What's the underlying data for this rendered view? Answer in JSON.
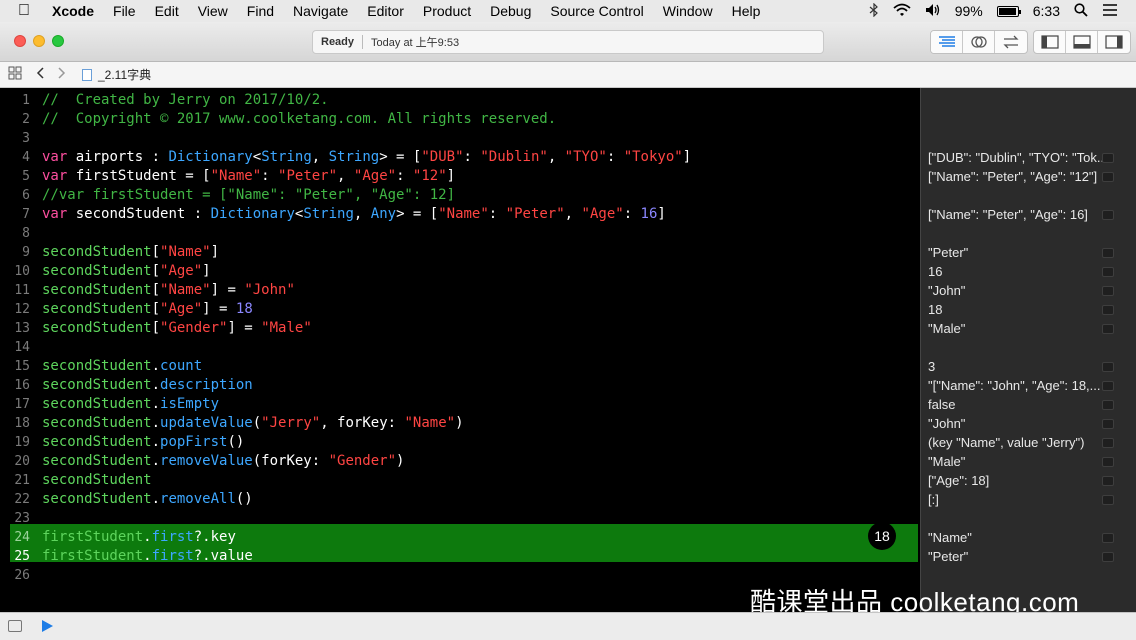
{
  "menubar": {
    "items": [
      "Xcode",
      "File",
      "Edit",
      "View",
      "Find",
      "Navigate",
      "Editor",
      "Product",
      "Debug",
      "Source Control",
      "Window",
      "Help"
    ],
    "battery": "99%",
    "time": "6:33"
  },
  "toolbar": {
    "status": "Ready",
    "timestamp": "Today at 上午9:53"
  },
  "jumpbar": {
    "filename": "_2.11字典"
  },
  "editor": {
    "badge": "18",
    "line_numbers": [
      "1",
      "2",
      "3",
      "4",
      "5",
      "6",
      "7",
      "8",
      "9",
      "10",
      "11",
      "12",
      "13",
      "14",
      "15",
      "16",
      "17",
      "18",
      "19",
      "20",
      "21",
      "22",
      "23",
      "24",
      "25",
      "26"
    ],
    "lines": [
      [
        [
          "cm",
          "//  Created by Jerry on 2017/10/2."
        ]
      ],
      [
        [
          "cm",
          "//  Copyright © 2017 www.coolketang.com. All rights reserved."
        ]
      ],
      [],
      [
        [
          "kw",
          "var"
        ],
        [
          "pl",
          " airports : "
        ],
        [
          "ty",
          "Dictionary"
        ],
        [
          "pl",
          "<"
        ],
        [
          "ty",
          "String"
        ],
        [
          "pl",
          ", "
        ],
        [
          "ty",
          "String"
        ],
        [
          "pl",
          "> = ["
        ],
        [
          "st",
          "\"DUB\""
        ],
        [
          "pl",
          ": "
        ],
        [
          "st",
          "\"Dublin\""
        ],
        [
          "pl",
          ", "
        ],
        [
          "st",
          "\"TYO\""
        ],
        [
          "pl",
          ": "
        ],
        [
          "st",
          "\"Tokyo\""
        ],
        [
          "pl",
          "]"
        ]
      ],
      [
        [
          "kw",
          "var"
        ],
        [
          "pl",
          " firstStudent = ["
        ],
        [
          "st",
          "\"Name\""
        ],
        [
          "pl",
          ": "
        ],
        [
          "st",
          "\"Peter\""
        ],
        [
          "pl",
          ", "
        ],
        [
          "st",
          "\"Age\""
        ],
        [
          "pl",
          ": "
        ],
        [
          "st",
          "\"12\""
        ],
        [
          "pl",
          "]"
        ]
      ],
      [
        [
          "cm",
          "//var firstStudent = [\"Name\": \"Peter\", \"Age\": 12]"
        ]
      ],
      [
        [
          "kw",
          "var"
        ],
        [
          "pl",
          " secondStudent : "
        ],
        [
          "ty",
          "Dictionary"
        ],
        [
          "pl",
          "<"
        ],
        [
          "ty",
          "String"
        ],
        [
          "pl",
          ", "
        ],
        [
          "ty",
          "Any"
        ],
        [
          "pl",
          "> = ["
        ],
        [
          "st",
          "\"Name\""
        ],
        [
          "pl",
          ": "
        ],
        [
          "st",
          "\"Peter\""
        ],
        [
          "pl",
          ", "
        ],
        [
          "st",
          "\"Age\""
        ],
        [
          "pl",
          ": "
        ],
        [
          "nm",
          "16"
        ],
        [
          "pl",
          "]"
        ]
      ],
      [],
      [
        [
          "vr",
          "secondStudent"
        ],
        [
          "pl",
          "["
        ],
        [
          "st",
          "\"Name\""
        ],
        [
          "pl",
          "]"
        ]
      ],
      [
        [
          "vr",
          "secondStudent"
        ],
        [
          "pl",
          "["
        ],
        [
          "st",
          "\"Age\""
        ],
        [
          "pl",
          "]"
        ]
      ],
      [
        [
          "vr",
          "secondStudent"
        ],
        [
          "pl",
          "["
        ],
        [
          "st",
          "\"Name\""
        ],
        [
          "pl",
          "] = "
        ],
        [
          "st",
          "\"John\""
        ]
      ],
      [
        [
          "vr",
          "secondStudent"
        ],
        [
          "pl",
          "["
        ],
        [
          "st",
          "\"Age\""
        ],
        [
          "pl",
          "] = "
        ],
        [
          "nm",
          "18"
        ]
      ],
      [
        [
          "vr",
          "secondStudent"
        ],
        [
          "pl",
          "["
        ],
        [
          "st",
          "\"Gender\""
        ],
        [
          "pl",
          "] = "
        ],
        [
          "st",
          "\"Male\""
        ]
      ],
      [],
      [
        [
          "vr",
          "secondStudent"
        ],
        [
          "pl",
          "."
        ],
        [
          "pr",
          "count"
        ]
      ],
      [
        [
          "vr",
          "secondStudent"
        ],
        [
          "pl",
          "."
        ],
        [
          "pr",
          "description"
        ]
      ],
      [
        [
          "vr",
          "secondStudent"
        ],
        [
          "pl",
          "."
        ],
        [
          "pr",
          "isEmpty"
        ]
      ],
      [
        [
          "vr",
          "secondStudent"
        ],
        [
          "pl",
          "."
        ],
        [
          "pr",
          "updateValue"
        ],
        [
          "pl",
          "("
        ],
        [
          "st",
          "\"Jerry\""
        ],
        [
          "pl",
          ", forKey: "
        ],
        [
          "st",
          "\"Name\""
        ],
        [
          "pl",
          ")"
        ]
      ],
      [
        [
          "vr",
          "secondStudent"
        ],
        [
          "pl",
          "."
        ],
        [
          "pr",
          "popFirst"
        ],
        [
          "pl",
          "()"
        ]
      ],
      [
        [
          "vr",
          "secondStudent"
        ],
        [
          "pl",
          "."
        ],
        [
          "pr",
          "removeValue"
        ],
        [
          "pl",
          "(forKey: "
        ],
        [
          "st",
          "\"Gender\""
        ],
        [
          "pl",
          ")"
        ]
      ],
      [
        [
          "vr",
          "secondStudent"
        ]
      ],
      [
        [
          "vr",
          "secondStudent"
        ],
        [
          "pl",
          "."
        ],
        [
          "pr",
          "removeAll"
        ],
        [
          "pl",
          "()"
        ]
      ],
      [],
      [
        [
          "vr",
          "firstStudent"
        ],
        [
          "pl",
          "."
        ],
        [
          "pr",
          "first"
        ],
        [
          "pl",
          "?.key"
        ]
      ],
      [
        [
          "vr",
          "firstStudent"
        ],
        [
          "pl",
          "."
        ],
        [
          "pr",
          "first"
        ],
        [
          "pl",
          "?.value"
        ]
      ],
      []
    ]
  },
  "results": {
    "lines": [
      "",
      "",
      "",
      "[\"DUB\": \"Dublin\", \"TYO\": \"Tok...",
      "[\"Name\": \"Peter\", \"Age\": \"12\"]",
      "",
      "[\"Name\": \"Peter\", \"Age\": 16]",
      "",
      "\"Peter\"",
      "16",
      "\"John\"",
      "18",
      "\"Male\"",
      "",
      "3",
      "\"[\"Name\": \"John\", \"Age\": 18,...",
      "false",
      "\"John\"",
      "(key \"Name\", value \"Jerry\")",
      "\"Male\"",
      "[\"Age\": 18]",
      "[:]",
      "",
      "\"Name\"",
      "\"Peter\"",
      ""
    ]
  },
  "watermark": "酷课堂出品 coolketang.com",
  "colors": {
    "highlight": "#0d7a0d",
    "comment": "#41b645",
    "keyword": "#ff4fa0",
    "type": "#3da7ff",
    "string": "#ff4543",
    "number": "#8b87ff"
  }
}
